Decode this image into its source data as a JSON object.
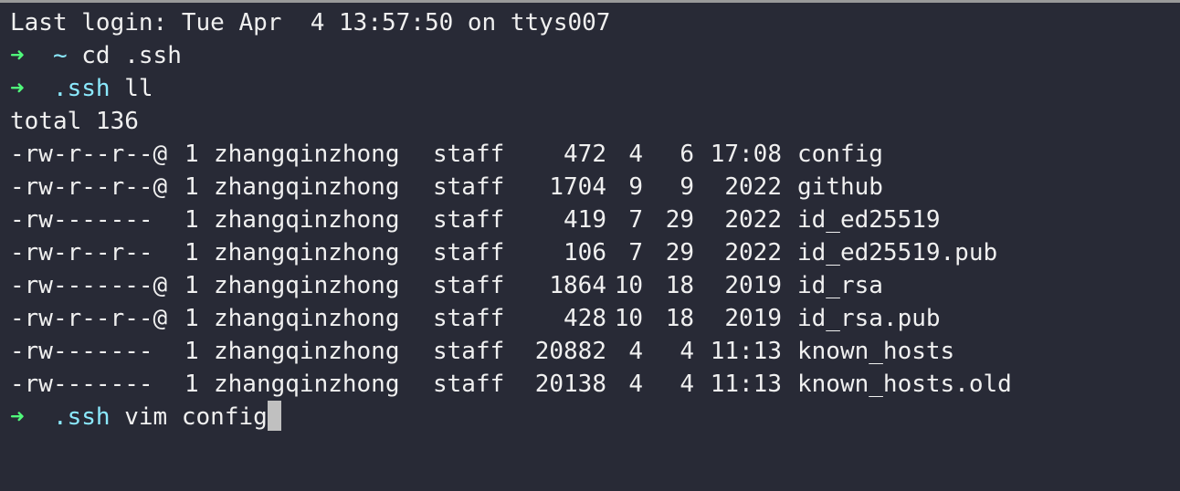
{
  "login": "Last login: Tue Apr  4 13:57:50 on ttys007",
  "prompt_symbol": "➜",
  "commands": [
    {
      "dir": "~",
      "cmd": "cd .ssh"
    },
    {
      "dir": ".ssh",
      "cmd": "ll"
    }
  ],
  "total": "total 136",
  "files": [
    {
      "perm": "-rw-r--r--@",
      "links": "1",
      "user": "zhangqinzhong",
      "group": "staff",
      "size": "472",
      "month": "4",
      "day": "6",
      "time": "17:08",
      "name": "config"
    },
    {
      "perm": "-rw-r--r--@",
      "links": "1",
      "user": "zhangqinzhong",
      "group": "staff",
      "size": "1704",
      "month": "9",
      "day": "9",
      "time": "2022",
      "name": "github"
    },
    {
      "perm": "-rw-------",
      "links": "1",
      "user": "zhangqinzhong",
      "group": "staff",
      "size": "419",
      "month": "7",
      "day": "29",
      "time": "2022",
      "name": "id_ed25519"
    },
    {
      "perm": "-rw-r--r--",
      "links": "1",
      "user": "zhangqinzhong",
      "group": "staff",
      "size": "106",
      "month": "7",
      "day": "29",
      "time": "2022",
      "name": "id_ed25519.pub"
    },
    {
      "perm": "-rw-------@",
      "links": "1",
      "user": "zhangqinzhong",
      "group": "staff",
      "size": "1864",
      "month": "10",
      "day": "18",
      "time": "2019",
      "name": "id_rsa"
    },
    {
      "perm": "-rw-r--r--@",
      "links": "1",
      "user": "zhangqinzhong",
      "group": "staff",
      "size": "428",
      "month": "10",
      "day": "18",
      "time": "2019",
      "name": "id_rsa.pub"
    },
    {
      "perm": "-rw-------",
      "links": "1",
      "user": "zhangqinzhong",
      "group": "staff",
      "size": "20882",
      "month": "4",
      "day": "4",
      "time": "11:13",
      "name": "known_hosts"
    },
    {
      "perm": "-rw-------",
      "links": "1",
      "user": "zhangqinzhong",
      "group": "staff",
      "size": "20138",
      "month": "4",
      "day": "4",
      "time": "11:13",
      "name": "known_hosts.old"
    }
  ],
  "current": {
    "dir": ".ssh",
    "input": "vim config"
  },
  "colors": {
    "background": "#282a36",
    "arrow": "#50fa7b",
    "directory": "#8be9fd",
    "text": "#f0f0f0",
    "cursor": "#c0c0c0"
  }
}
